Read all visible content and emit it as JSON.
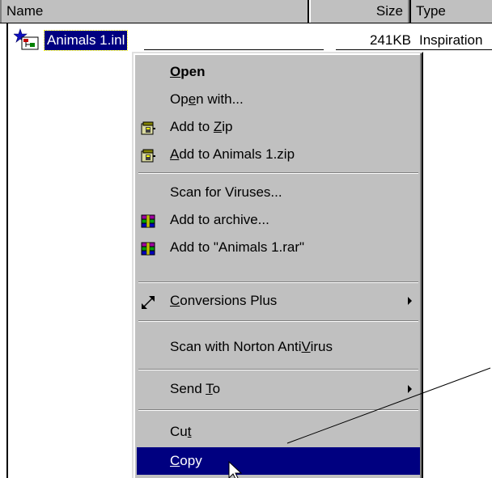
{
  "columns": {
    "name": "Name",
    "size": "Size",
    "type": "Type"
  },
  "file": {
    "name": "Animals 1.inl",
    "size": "241KB",
    "type": "Inspiration",
    "icon": "inspiration-file-icon"
  },
  "menu": {
    "open": {
      "pre": "",
      "accel": "O",
      "post": "pen"
    },
    "open_with": {
      "pre": "Op",
      "accel": "e",
      "post": "n with..."
    },
    "add_to_zip": {
      "pre": "Add to ",
      "accel": "Z",
      "post": "ip"
    },
    "add_to_animals_zip": {
      "pre": "",
      "accel": "A",
      "post": "dd to Animals 1.zip"
    },
    "scan_viruses": {
      "label": "Scan for Viruses..."
    },
    "add_to_archive": {
      "label": "Add to archive..."
    },
    "add_to_rar": {
      "label": "Add to \"Animals 1.rar\""
    },
    "conversions_plus": {
      "pre": "",
      "accel": "C",
      "post": "onversions Plus"
    },
    "norton": {
      "pre": "Scan with Norton Anti",
      "accel": "V",
      "post": "irus"
    },
    "send_to": {
      "pre": "Send ",
      "accel": "T",
      "post": "o"
    },
    "cut": {
      "pre": "Cu",
      "accel": "t",
      "post": ""
    },
    "copy": {
      "pre": "",
      "accel": "C",
      "post": "opy"
    }
  },
  "icons": {
    "zip": "winzip-icon",
    "rar": "winrar-icon",
    "conversions": "conversions-plus-icon",
    "cursor": "mouse-pointer-icon"
  },
  "colors": {
    "menu_bg": "#c0c0c0",
    "selection": "#000080",
    "selection_text": "#ffffff"
  }
}
